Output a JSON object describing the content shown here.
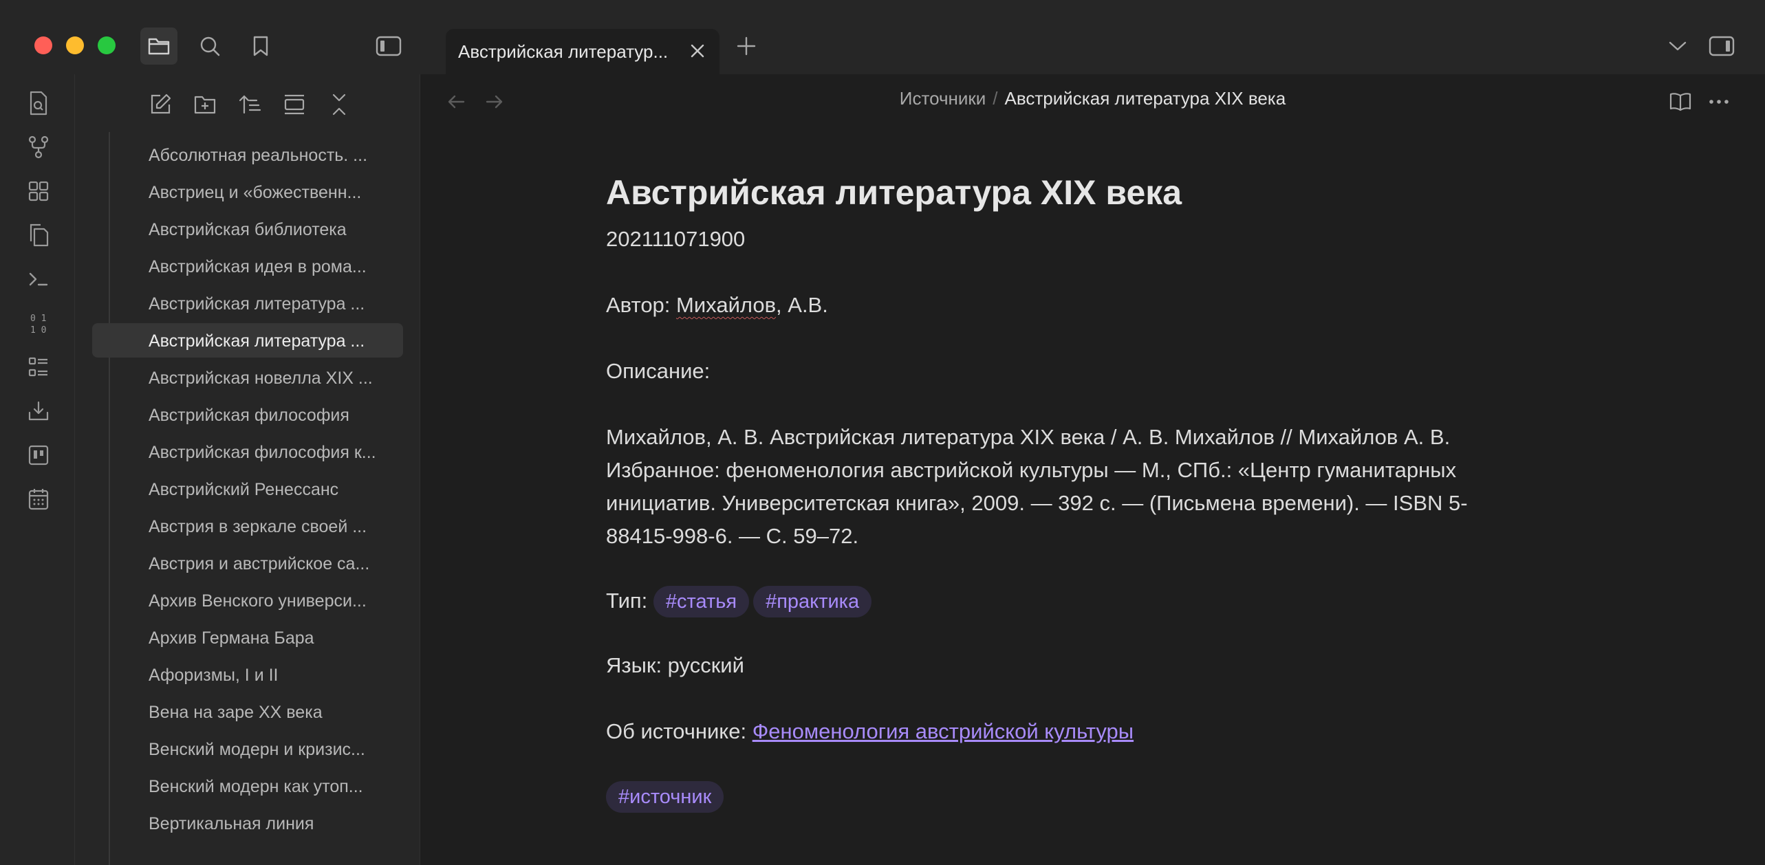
{
  "tab": {
    "title": "Австрийская литератур..."
  },
  "sidebar": {
    "files": [
      "Абсолютная реальность. ...",
      "Австриец и «божественн...",
      "Австрийская библиотека",
      "Австрийская идея в рома...",
      "Австрийская литература ...",
      "Австрийская литература ...",
      "Австрийская новелла XIX ...",
      "Австрийская философия",
      "Австрийская философия к...",
      "Австрийский Ренессанс",
      "Австрия в зеркале своей ...",
      "Австрия и австрийское са...",
      "Архив Венского универси...",
      "Архив Германа Бара",
      "Афоризмы, I и II",
      "Вена на заре XX века",
      "Венский модерн и кризис...",
      "Венский модерн как утоп...",
      "Вертикальная линия"
    ]
  },
  "breadcrumb": {
    "folder": "Источники",
    "separator": "/",
    "current": "Австрийская литература XIX века"
  },
  "note": {
    "title": "Австрийская литература XIX века",
    "id": "202111071900",
    "author_label": "Автор:",
    "author_name": "Михайлов",
    "author_initials": ", А.В.",
    "description_label": "Описание:",
    "citation": "Михайлов, А. В. Австрийская литература XIX века / А. В. Михайлов // Михайлов А. В. Избранное: феноменология австрийской культуры — М., СПб.: «Центр гуманитарных инициатив. Университетская книга», 2009. — 392 с. — (Письмена времени). — ISBN 5-88415-998-6. — С. 59–72.",
    "type_label": "Тип:",
    "type_tags": [
      "#статья",
      "#практика"
    ],
    "language": "Язык: русский",
    "about_label": "Об источнике:",
    "about_link": "Феноменология австрийской культуры",
    "footer_tag": "#источник"
  },
  "colors": {
    "accent": "#a88bfa",
    "tag_bg": "#2e2a3d",
    "close": "#ff5f57",
    "minimize": "#febc2e",
    "zoom": "#28c840"
  }
}
